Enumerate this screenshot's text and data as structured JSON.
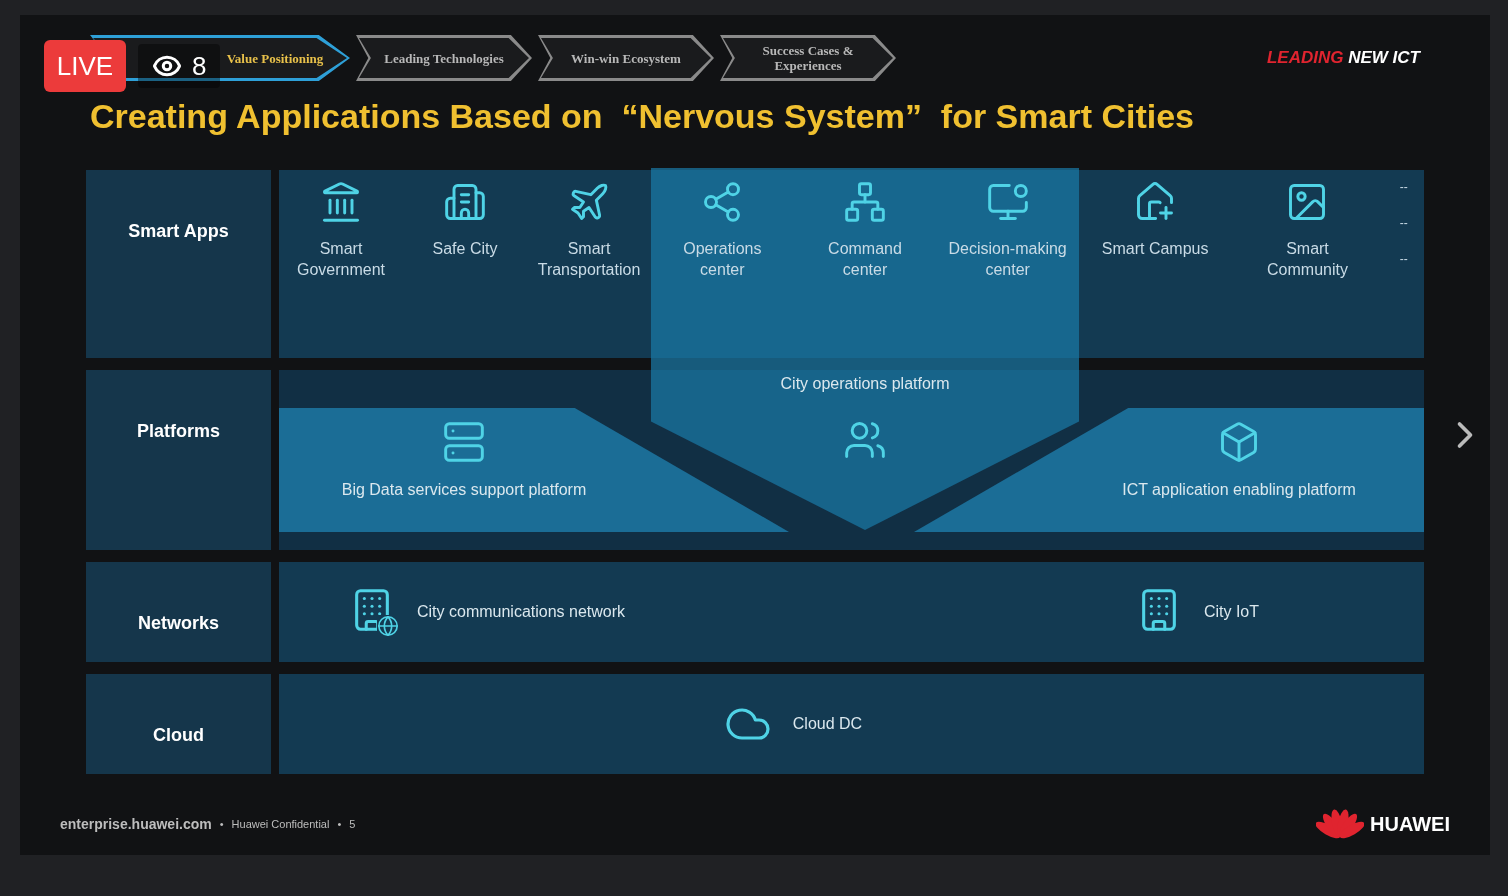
{
  "stream": {
    "live_badge": "LIVE",
    "viewer_count": "8"
  },
  "slide": {
    "nav_steps": [
      {
        "label": "Value Positioning",
        "selected": true
      },
      {
        "label": "Leading Technologies",
        "selected": false
      },
      {
        "label": "Win-win Ecosystem",
        "selected": false
      },
      {
        "label": "Success Cases & Experiences",
        "selected": false
      }
    ],
    "tagline": {
      "accent": "LEADING",
      "rest": "NEW ICT"
    },
    "title": "Creating Applications Based on  “Nervous System”  for Smart Cities",
    "layers": [
      {
        "kind": "apps",
        "label": "Smart Apps"
      },
      {
        "kind": "platforms",
        "label": "Platforms"
      },
      {
        "kind": "networks",
        "label": "Networks"
      },
      {
        "kind": "cloud",
        "label": "Cloud"
      }
    ],
    "apps_left": [
      {
        "kind": "landmark",
        "label": "Smart Government"
      },
      {
        "kind": "building",
        "label": "Safe City"
      },
      {
        "kind": "plane",
        "label": "Smart Transportation"
      }
    ],
    "apps_center": [
      {
        "kind": "share",
        "label": "Operations center"
      },
      {
        "kind": "network",
        "label": "Command center"
      },
      {
        "kind": "monitor",
        "label": "Decision-making center"
      }
    ],
    "apps_right": [
      {
        "kind": "house",
        "label": "Smart Campus"
      },
      {
        "kind": "image",
        "label": "Smart Community"
      }
    ],
    "more_marks": [
      "--",
      "--",
      "--"
    ],
    "city_platform": "City operations platform",
    "platform_left": "Big Data services support platform",
    "platform_right": "ICT application enabling platform",
    "networks": [
      {
        "kind": "globe",
        "label": "City communications network"
      },
      {
        "kind": "iot",
        "label": "City IoT"
      }
    ],
    "cloud": "Cloud DC",
    "footer": {
      "site": "enterprise.huawei.com",
      "separator": "•",
      "note": "Huawei Confidential",
      "page": "5",
      "brand": "HUAWEI"
    }
  }
}
